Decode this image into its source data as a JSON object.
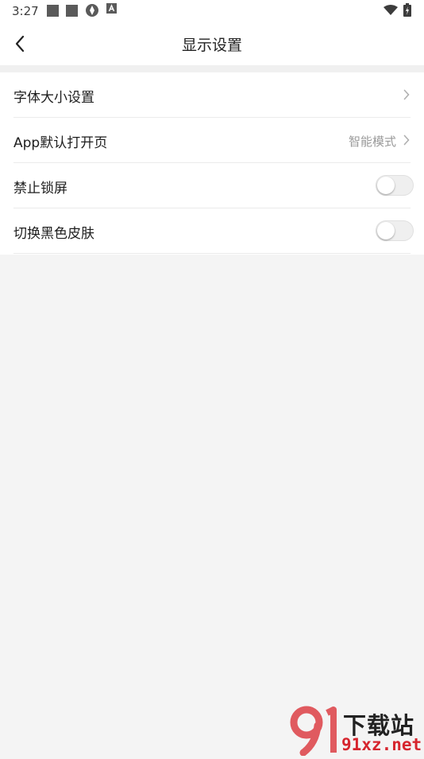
{
  "status_bar": {
    "time": "3:27"
  },
  "header": {
    "title": "显示设置"
  },
  "settings": [
    {
      "label": "字体大小设置",
      "value": "",
      "control": "chevron"
    },
    {
      "label": "App默认打开页",
      "value": "智能模式",
      "control": "chevron"
    },
    {
      "label": "禁止锁屏",
      "value": "",
      "control": "toggle",
      "checked": false
    },
    {
      "label": "切换黑色皮肤",
      "value": "",
      "control": "toggle",
      "checked": false
    }
  ],
  "watermark": {
    "top_text": "下载站",
    "bottom_text": "91xz.net",
    "number": "91"
  },
  "colors": {
    "toggle_off": "#efefef",
    "watermark_red": "#d6252e"
  }
}
